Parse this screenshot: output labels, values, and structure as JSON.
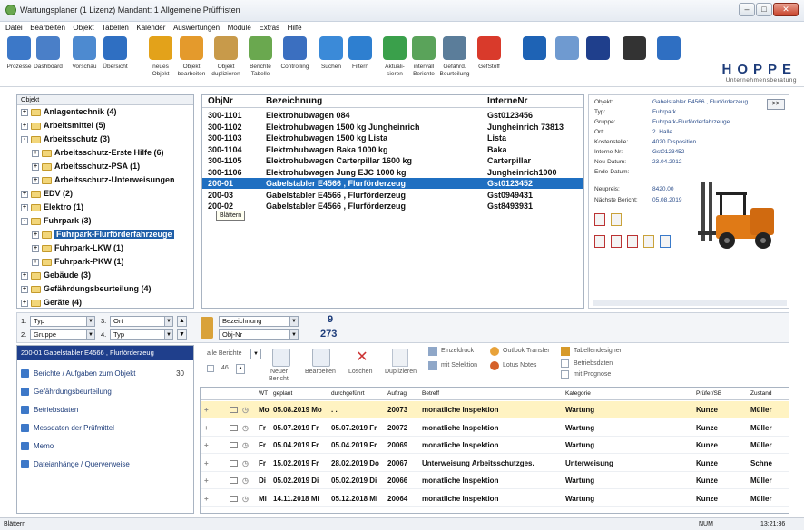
{
  "window": {
    "title": "Wartungsplaner (1 Lizenz)   Mandant: 1 Allgemeine Prüffristen"
  },
  "menu": [
    "Datei",
    "Bearbeiten",
    "Objekt",
    "Tabellen",
    "Kalender",
    "Auswertungen",
    "Module",
    "Extras",
    "Hilfe"
  ],
  "toolbar": [
    {
      "l1": "Prozesse",
      "l2": "",
      "icon": "clipboard-icon",
      "color": "#3c78c8"
    },
    {
      "l1": "Dashboard",
      "l2": "",
      "icon": "dashboard-icon",
      "color": "#4a7fc8"
    },
    {
      "l1": "Vorschau",
      "l2": "",
      "icon": "preview-icon",
      "color": "#4d8ad0"
    },
    {
      "l1": "Übersicht",
      "l2": "",
      "icon": "globe-icon",
      "color": "#2f6fc2"
    },
    {
      "l1": "neues",
      "l2": "Objekt",
      "icon": "new-object-icon",
      "color": "#e3a21a"
    },
    {
      "l1": "Objekt",
      "l2": "bearbeiten",
      "icon": "edit-object-icon",
      "color": "#e49a2c"
    },
    {
      "l1": "Objekt",
      "l2": "duplizieren",
      "icon": "duplicate-object-icon",
      "color": "#c89a4a"
    },
    {
      "l1": "Berichte",
      "l2": "Tabelle",
      "icon": "report-table-icon",
      "color": "#6aa84f"
    },
    {
      "l1": "Controlling",
      "l2": "",
      "icon": "chart-icon",
      "color": "#3b6fc0"
    },
    {
      "l1": "Suchen",
      "l2": "",
      "icon": "search-icon",
      "color": "#3b8ad8"
    },
    {
      "l1": "Filtern",
      "l2": "",
      "icon": "filter-icon",
      "color": "#2e7fd0"
    },
    {
      "l1": "Aktuali-",
      "l2": "sieren",
      "icon": "refresh-icon",
      "color": "#3aa04b"
    },
    {
      "l1": "intervall",
      "l2": "Berichte",
      "icon": "interval-reports-icon",
      "color": "#5aa35a"
    },
    {
      "l1": "Gefährd.",
      "l2": "Beurteilung",
      "icon": "risk-assessment-icon",
      "color": "#5b7d9a"
    },
    {
      "l1": "GefStoff",
      "l2": "",
      "icon": "hazard-icon",
      "color": "#d93a2b"
    },
    {
      "l1": "",
      "l2": "",
      "icon": "mobile-icon",
      "color": "#1e63b5"
    },
    {
      "l1": "",
      "l2": "",
      "icon": "scanner-icon",
      "color": "#6f9ad0"
    },
    {
      "l1": "",
      "l2": "",
      "icon": "rfid-icon",
      "color": "#1f3f8c"
    },
    {
      "l1": "",
      "l2": "",
      "icon": "camera-icon",
      "color": "#333333"
    },
    {
      "l1": "",
      "l2": "",
      "icon": "help-icon",
      "color": "#2f6fc2"
    }
  ],
  "brand": {
    "name": "HOPPE",
    "sub": "Unternehmensberatung"
  },
  "tree": {
    "header": "Objekt",
    "nodes": [
      {
        "label": "Anlagentechnik  (4)",
        "level": 0,
        "exp": "+"
      },
      {
        "label": "Arbeitsmittel  (5)",
        "level": 0,
        "exp": "+"
      },
      {
        "label": "Arbeitsschutz  (3)",
        "level": 0,
        "exp": "-"
      },
      {
        "label": "Arbeitsschutz-Erste Hilfe  (6)",
        "level": 1,
        "exp": "+"
      },
      {
        "label": "Arbeitsschutz-PSA  (1)",
        "level": 1,
        "exp": "+"
      },
      {
        "label": "Arbeitsschutz-Unterweisungen",
        "level": 1,
        "exp": "+"
      },
      {
        "label": "EDV  (2)",
        "level": 0,
        "exp": "+"
      },
      {
        "label": "Elektro  (1)",
        "level": 0,
        "exp": "+"
      },
      {
        "label": "Fuhrpark  (3)",
        "level": 0,
        "exp": "-"
      },
      {
        "label": "Fuhrpark-Flurförderfahrzeuge",
        "level": 1,
        "exp": "+",
        "selected": true
      },
      {
        "label": "Fuhrpark-LKW  (1)",
        "level": 1,
        "exp": "+"
      },
      {
        "label": "Fuhrpark-PKW  (1)",
        "level": 1,
        "exp": "+"
      },
      {
        "label": "Gebäude  (3)",
        "level": 0,
        "exp": "+"
      },
      {
        "label": "Gefährdungsbeurteilung  (4)",
        "level": 0,
        "exp": "+"
      },
      {
        "label": "Geräte  (4)",
        "level": 0,
        "exp": "+"
      },
      {
        "label": "Personal  (1)",
        "level": 0,
        "exp": "+"
      }
    ]
  },
  "grid": {
    "headers": [
      "ObjNr",
      "Bezeichnung",
      "InterneNr"
    ],
    "rows": [
      [
        "300-1101",
        "Elektrohubwagen 084",
        "Gst0123456"
      ],
      [
        "300-1102",
        "Elektrohubwagen 1500 kg  Jungheinrich",
        "Jungheinrich 73813"
      ],
      [
        "300-1103",
        "Elektrohubwagen 1500 kg Lista",
        "Lista"
      ],
      [
        "300-1104",
        "Elektrohubwagen Baka 1000 kg",
        "Baka"
      ],
      [
        "300-1105",
        "Elektrohubwagen Carterpillar 1600 kg",
        "Carterpillar"
      ],
      [
        "300-1106",
        "Elektrohubwagen Jung EJC 1000 kg",
        "Jungheinrich1000"
      ],
      [
        "200-01",
        "Gabelstabler E4566 , Flurförderzeug",
        "Gst0123452"
      ],
      [
        "200-03",
        "Gabelstabler E4566 , Flurförderzeug",
        "Gst0949431"
      ],
      [
        "200-02",
        "Gabelstabler E4566 , Flurförderzeug",
        "Gst8493931"
      ]
    ],
    "selected_row": 6,
    "tooltip": "Blättern"
  },
  "detail": {
    "fields": [
      [
        "Objekt:",
        "Gabelstabler E4566 , Flurförderzeug"
      ],
      [
        "Typ:",
        "Fuhrpark"
      ],
      [
        "Gruppe:",
        "Fuhrpark-Flurförderfahrzeuge"
      ],
      [
        "Ort:",
        "2. Halle"
      ],
      [
        "Kostenstelle:",
        "4020 Disposition"
      ],
      [
        "Interne-Nr:",
        "Gst0123452"
      ],
      [
        "Neu-Datum:",
        "23.04.2012"
      ],
      [
        "Ende-Datum:",
        ""
      ],
      [
        "Neupreis:",
        "8420.00"
      ],
      [
        "Nächste Bericht:",
        "05.08.2019"
      ]
    ],
    "expand_label": ">>"
  },
  "filters": {
    "f1": {
      "num": "1.",
      "value": "Typ"
    },
    "f2": {
      "num": "2.",
      "value": "Gruppe"
    },
    "f3": {
      "num": "3.",
      "value": "Ort"
    },
    "f4": {
      "num": "4.",
      "value": "Typ"
    },
    "search_field": "Bezeichnung",
    "sort_field": "Obj-Nr",
    "count_filtered": "9",
    "count_total": "273"
  },
  "nav": {
    "header": "200-01 Gabelstabler E4566 , Flurförderzeug",
    "items": [
      {
        "label": "Berichte / Aufgaben zum Objekt",
        "count": "30"
      },
      {
        "label": "Gefährdungsbeurteilung",
        "count": ""
      },
      {
        "label": "Betriebsdaten",
        "count": ""
      },
      {
        "label": "Messdaten der Prüfmittel",
        "count": ""
      },
      {
        "label": "Memo",
        "count": ""
      },
      {
        "label": "Dateianhänge / Querverweise",
        "count": ""
      }
    ]
  },
  "lower_toolbar": {
    "all_reports": "alle Berichte",
    "count": "46",
    "neuer": "Neuer",
    "bericht": "Bericht",
    "bearbeiten": "Bearbeiten",
    "loeschen": "Löschen",
    "duplizieren": "Duplizieren",
    "einzeldruck": "Einzeldruck",
    "outlook": "Outlook Transfer",
    "tabellendesigner": "Tabellendesigner",
    "selektion": "mit Selektion",
    "lotus": "Lotus Notes",
    "betriebsdaten": "Betriebsdaten",
    "prognose": "mit Prognose"
  },
  "reports": {
    "headers": [
      "WT",
      "geplant",
      "durchgeführt",
      "Auftrag",
      "Betreff",
      "Kategorie",
      "Prüfer/SB",
      "Zustand"
    ],
    "rows": [
      [
        "Mo",
        "05.08.2019 Mo",
        ". .",
        "20073",
        "monatliche Inspektion",
        "Wartung",
        "Kunze",
        "Müller"
      ],
      [
        "Fr",
        "05.07.2019 Fr",
        "05.07.2019 Fr",
        "20072",
        "monatliche Inspektion",
        "Wartung",
        "Kunze",
        "Müller"
      ],
      [
        "Fr",
        "05.04.2019 Fr",
        "05.04.2019 Fr",
        "20069",
        "monatliche Inspektion",
        "Wartung",
        "Kunze",
        "Müller"
      ],
      [
        "Fr",
        "15.02.2019 Fr",
        "28.02.2019 Do",
        "20067",
        "Unterweisung Arbeitsschutzges.",
        "Unterweisung",
        "Kunze",
        "Schne"
      ],
      [
        "Di",
        "05.02.2019 Di",
        "05.02.2019 Di",
        "20066",
        "monatliche Inspektion",
        "Wartung",
        "Kunze",
        "Müller"
      ],
      [
        "Mi",
        "14.11.2018 Mi",
        "05.12.2018 Mi",
        "20064",
        "monatliche Inspektion",
        "Wartung",
        "Kunze",
        "Müller"
      ]
    ]
  },
  "status": {
    "left": "Blättern",
    "num": "NUM",
    "time": "13:21:36"
  }
}
